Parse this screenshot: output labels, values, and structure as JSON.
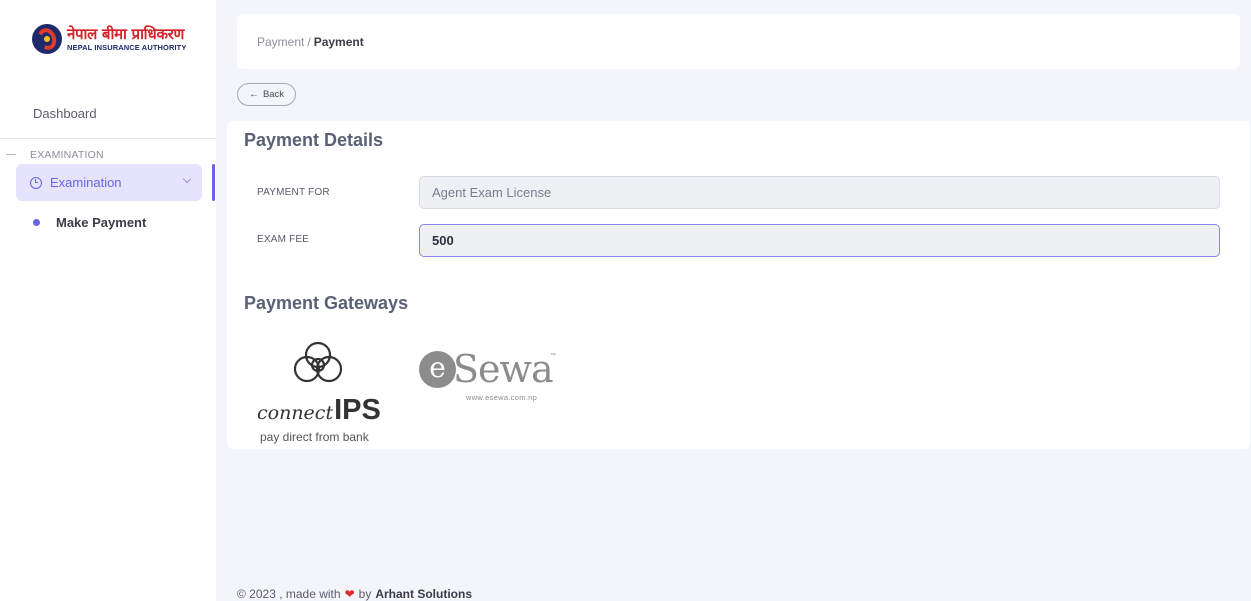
{
  "sidebar": {
    "logo": {
      "title": "नेपाल बीमा प्राधिकरण",
      "subtitle": "NEPAL INSURANCE AUTHORITY"
    },
    "dashboard_label": "Dashboard",
    "section_label": "EXAMINATION",
    "examination_label": "Examination",
    "make_payment_label": "Make Payment",
    "accent_color": "#6b63e8"
  },
  "header": {
    "breadcrumb_parent": "Payment",
    "breadcrumb_separator": "/",
    "breadcrumb_current": "Payment"
  },
  "back_button": {
    "label": "Back"
  },
  "payment_details": {
    "heading": "Payment Details",
    "payment_for_label": "PAYMENT FOR",
    "payment_for_value": "Agent Exam License",
    "exam_fee_label": "EXAM FEE",
    "exam_fee_value": "500"
  },
  "gateways": {
    "heading": "Payment Gateways",
    "connectips": {
      "word": "connect",
      "brand": "IPS",
      "tagline": "pay direct from bank"
    },
    "esewa": {
      "letter": "e",
      "word": "Sewa",
      "tm": "™",
      "url": "www.esewa.com.np"
    }
  },
  "footer": {
    "prefix": "© 2023 , made with",
    "by": "by",
    "author": "Arhant Solutions"
  },
  "icons": [
    "logo-icon",
    "clock-icon",
    "chevron-down-icon",
    "back-arrow-icon",
    "heart-icon",
    "connectips-logo",
    "esewa-logo"
  ]
}
